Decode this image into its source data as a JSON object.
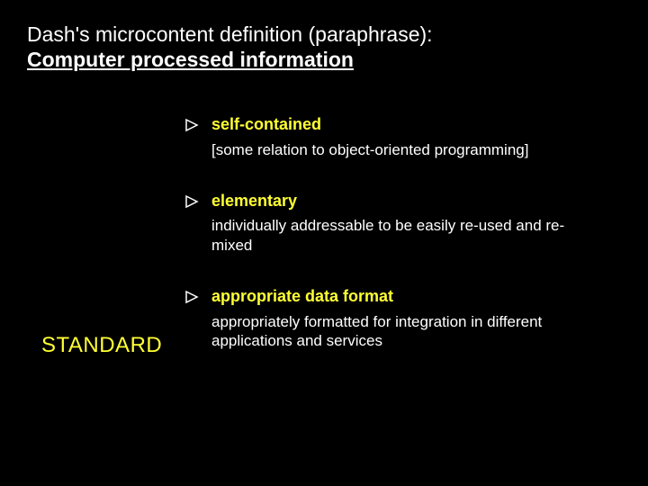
{
  "header": {
    "title": "Dash's microcontent definition (paraphrase):",
    "subtitle": "Computer processed information"
  },
  "bullets": [
    {
      "title": "self-contained",
      "desc": "[some relation to object-oriented programming]"
    },
    {
      "title": "elementary",
      "desc": "individually addressable to be easily re-used and re-mixed"
    },
    {
      "title": "appropriate data format",
      "desc": "appropriately formatted for integration in different applications and services"
    }
  ],
  "sideLabel": "STANDARD"
}
